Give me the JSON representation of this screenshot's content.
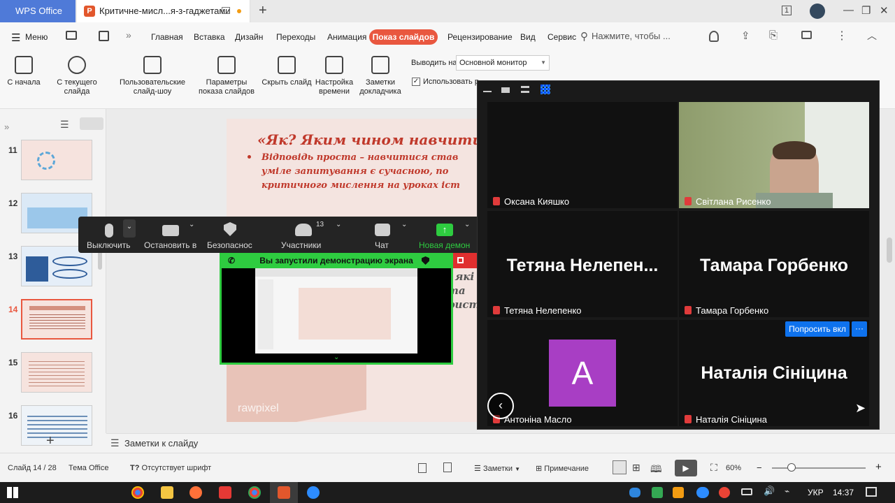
{
  "titlebar": {
    "home_tab": "WPS Office",
    "doc_tab": "Критичне-мисл...я-з-гаджетами",
    "new_tab_icon": "plus-icon"
  },
  "menu": {
    "menu_label": "Меню",
    "tabs": [
      "Главная",
      "Вставка",
      "Дизайн",
      "Переходы",
      "Анимация",
      "Показ слайдов",
      "Рецензирование",
      "Вид",
      "Сервис"
    ],
    "active_tab": "Показ слайдов",
    "search_placeholder": "Нажмите, чтобы ..."
  },
  "ribbon": {
    "from_start": "С начала",
    "from_current": "С текущего слайда",
    "custom_show": "Пользовательские слайд-шоу",
    "show_params": "Параметры показа слайдов",
    "hide_slide": "Скрыть слайд",
    "timing": "Настройка времени",
    "speaker_notes": "Заметки докладчика",
    "output_label": "Выводить на:",
    "output_value": "Основной монитор",
    "use_label": "Использовать р"
  },
  "slides": {
    "numbers": [
      "11",
      "12",
      "13",
      "14",
      "15",
      "16"
    ],
    "active": "14"
  },
  "slide": {
    "title": "«Як? Яким чином навчити",
    "line1": "Відповідь проста – навчитися став",
    "line2": "уміле запитування є   сучасною, по",
    "line3": "критичного мислення на уроках іст",
    "watermark": "rawpixel"
  },
  "notes": {
    "label": "Заметки к слайду"
  },
  "status": {
    "slide_info": "Слайд 14 / 28",
    "theme": "Тема Office",
    "font_missing": "Отсутствует шрифт",
    "notes_btn": "Заметки",
    "comment_btn": "Примечание",
    "zoom": "60%",
    "zoom_fraction": 0.6
  },
  "taskbar": {
    "lang": "УКР",
    "time": "14:37"
  },
  "zoom_toolbar": {
    "mute": "Выключить",
    "stop_video": "Остановить в",
    "security": "Безопаснос",
    "participants": "Участники",
    "participants_count": "13",
    "chat": "Чат",
    "new_share": "Новая демон",
    "share_banner": "Вы запустили демонстрацию экрана"
  },
  "gallery": {
    "tiles": [
      {
        "name": "Оксана Кияшко",
        "big": ""
      },
      {
        "name": "Світлана Рисенко",
        "big": ""
      },
      {
        "name": "Тетяна Нелепенко",
        "big": "Тетяна  Нелепен..."
      },
      {
        "name": "Тамара Горбенко",
        "big": "Тамара Горбенко"
      },
      {
        "name": "Антоніна Масло",
        "big": "",
        "avatar_letter": "A"
      },
      {
        "name": "Наталія Сініцина",
        "big": "Наталія Сініцина"
      }
    ],
    "ask_unmute": "Попросить вкл",
    "more": "···"
  },
  "colors": {
    "accent": "#e9573f",
    "wps_blue": "#4f7ad8",
    "zoom_green": "#2ecc40",
    "zoom_blue": "#0e72ed",
    "avatar_purple": "#a83ec4"
  }
}
